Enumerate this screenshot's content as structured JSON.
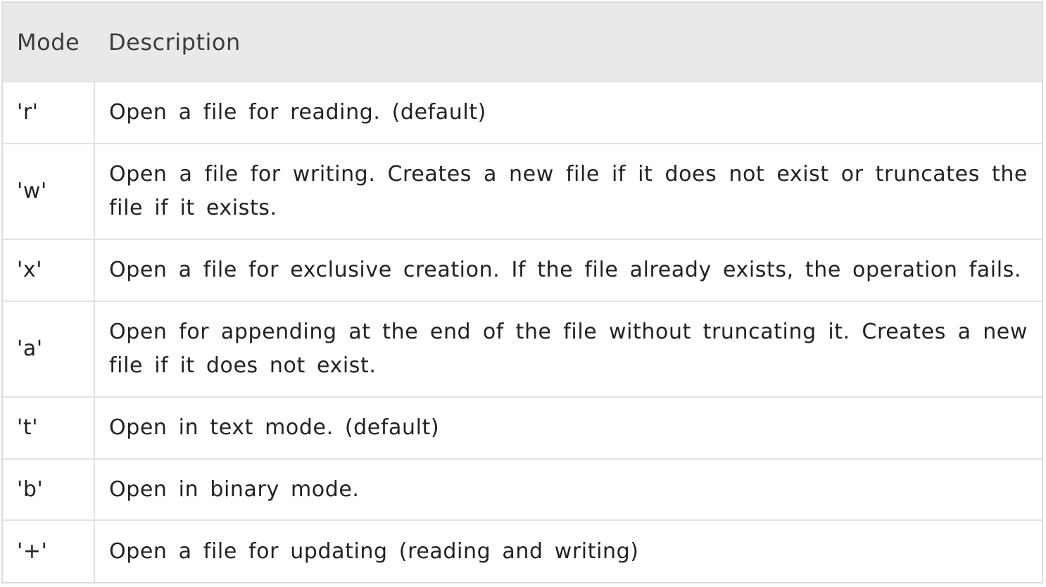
{
  "table": {
    "headers": {
      "mode": "Mode",
      "description": "Description"
    },
    "rows": [
      {
        "mode": "'r'",
        "description": "Open a file for reading. (default)"
      },
      {
        "mode": "'w'",
        "description": "Open a file for writing. Creates a new file if it does not exist or truncates the file if it exists."
      },
      {
        "mode": "'x'",
        "description": "Open a file for exclusive creation. If the file already exists, the operation fails."
      },
      {
        "mode": "'a'",
        "description": "Open for appending at the end of the file without truncating it. Creates a new file if it does not exist."
      },
      {
        "mode": "'t'",
        "description": "Open in text mode. (default)"
      },
      {
        "mode": "'b'",
        "description": "Open in binary mode."
      },
      {
        "mode": "'+'",
        "description": "Open a file for updating (reading and writing)"
      }
    ]
  },
  "colors": {
    "header_background": "#e9e9eb",
    "border": "#e2e2e2",
    "text": "#222222"
  }
}
